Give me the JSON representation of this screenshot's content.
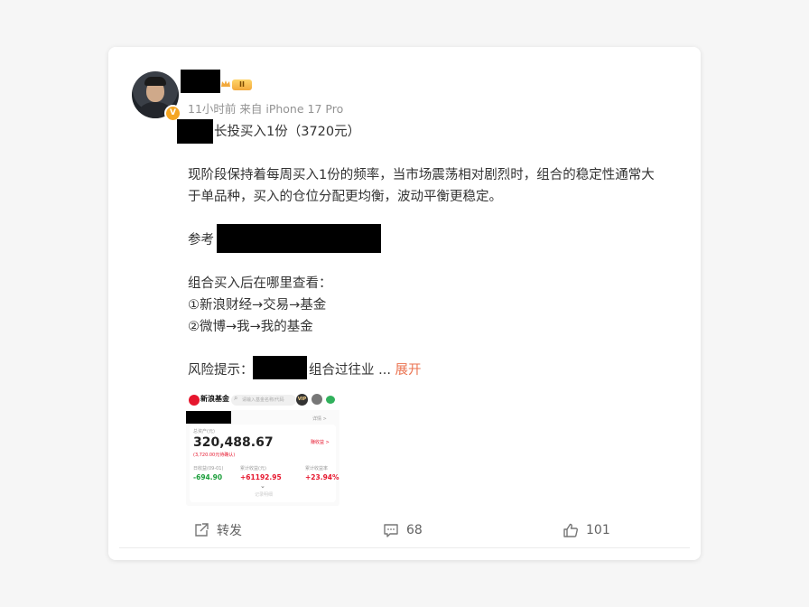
{
  "post": {
    "meta": "11小时前 来自 iPhone 17 Pro",
    "level_badge": "II",
    "verify_mark": "V",
    "line1": "长投买入1份（3720元）",
    "para1_l1": "现阶段保持着每周买入1份的频率，当市场震荡相对剧烈时，组合的稳定性通常大",
    "para1_l2": "于单品种，买入的仓位分配更均衡，波动平衡更稳定。",
    "ref_label": "参考",
    "where_title": "组合买入后在哪里查看：",
    "where_1": "①新浪财经→交易→基金",
    "where_2": "②微博→我→我的基金",
    "risk_label": "风险提示：",
    "risk_tail": "组合过往业 ...",
    "expand": "展开"
  },
  "image": {
    "logo_text": "新浪基金",
    "search_placeholder": "请输入基金名称/代码",
    "vip": "VIP",
    "detail_link": "详情 >",
    "total_label": "总资产(元)",
    "total_value": "320,488.67",
    "pending": "(3,720.00元待确认)",
    "earnings_link": "赚收益 >",
    "daily_label": "日收益(09-01)",
    "cum_label": "累计收益(元)",
    "cum_rate_label": "累计收益率",
    "daily_value": "-694.90",
    "cum_value": "+61192.95",
    "cum_rate_value": "+23.94%",
    "footnote": "记录明细",
    "colors": {
      "red": "#e6162d",
      "green": "#1a9e3a"
    }
  },
  "actions": {
    "repost": "转发",
    "comments": "68",
    "likes": "101"
  }
}
